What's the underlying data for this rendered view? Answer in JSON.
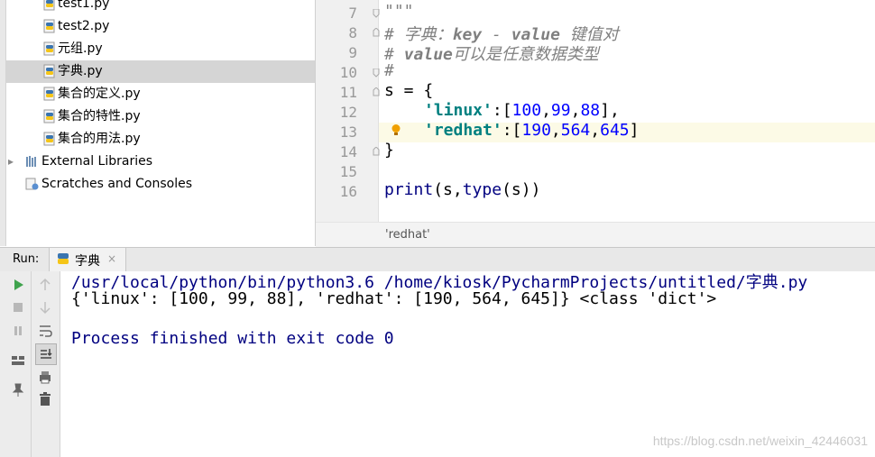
{
  "project_tree": {
    "items": [
      {
        "label": "test1.py",
        "type": "py"
      },
      {
        "label": "test2.py",
        "type": "py"
      },
      {
        "label": "元组.py",
        "type": "py"
      },
      {
        "label": "字典.py",
        "type": "py",
        "selected": true
      },
      {
        "label": "集合的定义.py",
        "type": "py"
      },
      {
        "label": "集合的特性.py",
        "type": "py"
      },
      {
        "label": "集合的用法.py",
        "type": "py"
      },
      {
        "label": "External Libraries",
        "type": "library"
      },
      {
        "label": "Scratches and Consoles",
        "type": "scratch"
      }
    ]
  },
  "editor": {
    "line_numbers": [
      "7",
      "8",
      "9",
      "10",
      "11",
      "12",
      "13",
      "14",
      "15",
      "16"
    ],
    "current_line": "13",
    "lines": {
      "l7": "\"\"\"",
      "l8": "# 字典：key - value 键值对",
      "l9": "# value可以是任意数据类型",
      "l10": "#",
      "l11_a": "s = {",
      "l12_key": "'linux'",
      "l12_colon": ":[",
      "l12_n1": "100",
      "l12_c1": ",",
      "l12_n2": "99",
      "l12_c2": ",",
      "l12_n3": "88",
      "l12_end": "],",
      "l13_key": "'redhat'",
      "l13_colon": ":[",
      "l13_n1": "190",
      "l13_c1": ",",
      "l13_n2": "564",
      "l13_c2": ",",
      "l13_n3": "645",
      "l13_end": "]",
      "l14": "}",
      "l16": "print(s,type(s))"
    },
    "breadcrumb": "'redhat'"
  },
  "run": {
    "label": "Run:",
    "tab_name": "字典",
    "tab_close": "×",
    "output": [
      "/usr/local/python/bin/python3.6 /home/kiosk/PycharmProjects/untitled/字典.py",
      "{'linux': [100, 99, 88], 'redhat': [190, 564, 645]} <class 'dict'>",
      "",
      "Process finished with exit code 0"
    ]
  },
  "watermark": "https://blog.csdn.net/weixin_42446031",
  "colors": {
    "comment": "#808080",
    "string": "#008080",
    "number": "#0000ff",
    "console_text": "#000080",
    "selection": "#d5d5d5",
    "current_line": "#fcfae6"
  }
}
